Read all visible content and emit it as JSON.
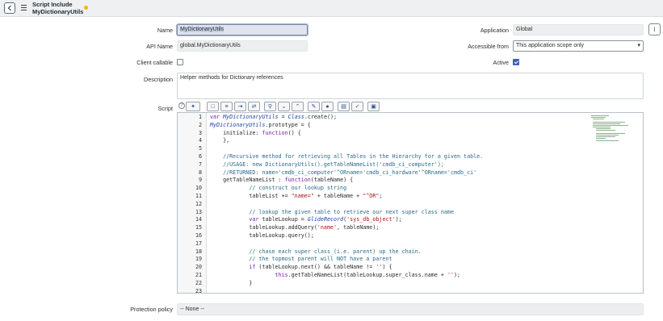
{
  "header": {
    "title_line1": "Script Include",
    "title_line2": "MyDictionaryUtils",
    "dirty_color": "#f6b700"
  },
  "form": {
    "name_label": "Name",
    "name_value": "MyDictionaryUtils",
    "api_name_label": "API Name",
    "api_name_value": "global.MyDictionaryUtils",
    "client_callable_label": "Client callable",
    "client_callable": false,
    "application_label": "Application",
    "application_value": "Global",
    "accessible_from_label": "Accessible from",
    "accessible_from_value": "This application scope only",
    "active_label": "Active",
    "active": true,
    "description_label": "Description",
    "description_value": "Helper methods for Dictionary references",
    "script_label": "Script",
    "protection_label": "Protection policy",
    "protection_value": "-- None --"
  },
  "toolbar": {
    "buttons": [
      "script-assist",
      "comment",
      "format",
      "format-code",
      "replace",
      "search",
      "find-next",
      "find-previous",
      "replace-all",
      "help",
      "save",
      "toggle-syntax",
      "fullscreen"
    ]
  },
  "editor": {
    "lines": [
      {
        "n": "1",
        "text": "var MyDictionaryUtils = Class.create();"
      },
      {
        "n": "2",
        "text": "MyDictionaryUtils.prototype = {"
      },
      {
        "n": "3",
        "text": "    initialize: function() {"
      },
      {
        "n": "4",
        "text": "    },"
      },
      {
        "n": "5",
        "text": ""
      },
      {
        "n": "6",
        "text": "    //Recursive method for retrieving all Tables in the Hierarchy for a given table."
      },
      {
        "n": "7",
        "text": "    //USAGE: new DictionaryUtils().getTableNameList('cmdb_ci_computer');"
      },
      {
        "n": "8",
        "text": "    //RETURNED: name='cmdb_ci_computer'^ORname='cmdb_ci_hardware'^ORname='cmdb_ci'"
      },
      {
        "n": "9",
        "text": "    getTableNameList : function(tableName) {"
      },
      {
        "n": "10",
        "text": "            // construct our lookup string"
      },
      {
        "n": "11",
        "text": "            tableList += \"name=\" + tableName + \"^OR\";"
      },
      {
        "n": "12",
        "text": ""
      },
      {
        "n": "13",
        "text": "            // lookup the given table to retrieve our next super class name"
      },
      {
        "n": "14",
        "text": "            var tableLookup = GlideRecord('sys_db_object');"
      },
      {
        "n": "15",
        "text": "            tableLookup.addQuery('name', tableName);"
      },
      {
        "n": "16",
        "text": "            tableLookup.query();"
      },
      {
        "n": "17",
        "text": ""
      },
      {
        "n": "18",
        "text": "            // chase each super class (i.e. parent) up the chain."
      },
      {
        "n": "19",
        "text": "            // the topmost parent will NOT have a parent"
      },
      {
        "n": "20",
        "text": "            if (tableLookup.next() && tableName != '') {"
      },
      {
        "n": "21",
        "text": "                    this.getTableNameList(tableLookup.super_class.name + '');"
      },
      {
        "n": "22",
        "text": "            }"
      },
      {
        "n": "23",
        "text": ""
      }
    ]
  }
}
